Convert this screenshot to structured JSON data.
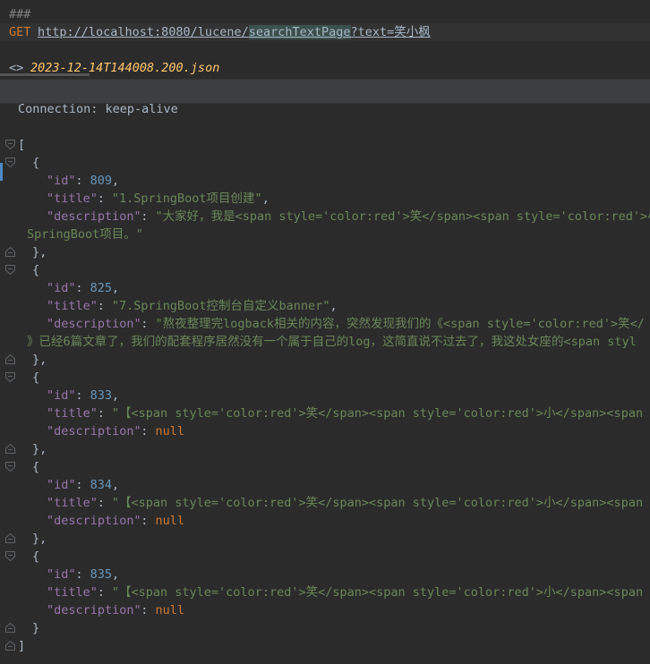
{
  "request": {
    "separator": "###",
    "method": "GET",
    "url_base": "http://localhost:8080/lucene/",
    "url_path": "searchTextPage",
    "url_query": "?text=笑小枫"
  },
  "response_file": {
    "arrows": "<>",
    "name": "2023-12-14T144008.200.json"
  },
  "header": {
    "line": "Connection: keep-alive"
  },
  "json": {
    "open": "[",
    "close": "]",
    "records": [
      {
        "id": "809",
        "title": "\"1.SpringBoot项目创建\"",
        "description": "\"大家好，我是<span style='color:red'>笑</span><span style='color:red'>小",
        "description_wrap": "SpringBoot项目。\""
      },
      {
        "id": "825",
        "title": "\"7.SpringBoot控制台自定义banner\"",
        "description": "\"熬夜整理完logback相关的内容，突然发现我们的《<span style='color:red'>笑</",
        "description_wrap": "》已经6篇文章了，我们的配套程序居然没有一个属于自己的log，这简直说不过去了，我这处女座的<span styl"
      },
      {
        "id": "833",
        "title": "\"【<span style='color:red'>笑</span><span style='color:red'>小</span><span s",
        "description": "null"
      },
      {
        "id": "834",
        "title": "\"【<span style='color:red'>笑</span><span style='color:red'>小</span><span s",
        "description": "null"
      },
      {
        "id": "835",
        "title": "\"【<span style='color:red'>笑</span><span style='color:red'>小</span><span s",
        "description": "null"
      }
    ],
    "keys": {
      "id": "\"id\"",
      "title": "\"title\"",
      "description": "\"description\""
    },
    "punct": {
      "obj_open": "{",
      "obj_close": "}",
      "obj_close_comma": "},",
      "colon": ": ",
      "comma": ","
    }
  },
  "icons": {
    "fold_open": "fold-open-icon",
    "fold_close": "fold-close-icon"
  },
  "colors": {
    "background": "#2b2b2b",
    "key": "#9876aa",
    "string": "#6a8759",
    "number": "#6897bb",
    "keyword": "#cc7832",
    "file": "#ffc66d"
  }
}
